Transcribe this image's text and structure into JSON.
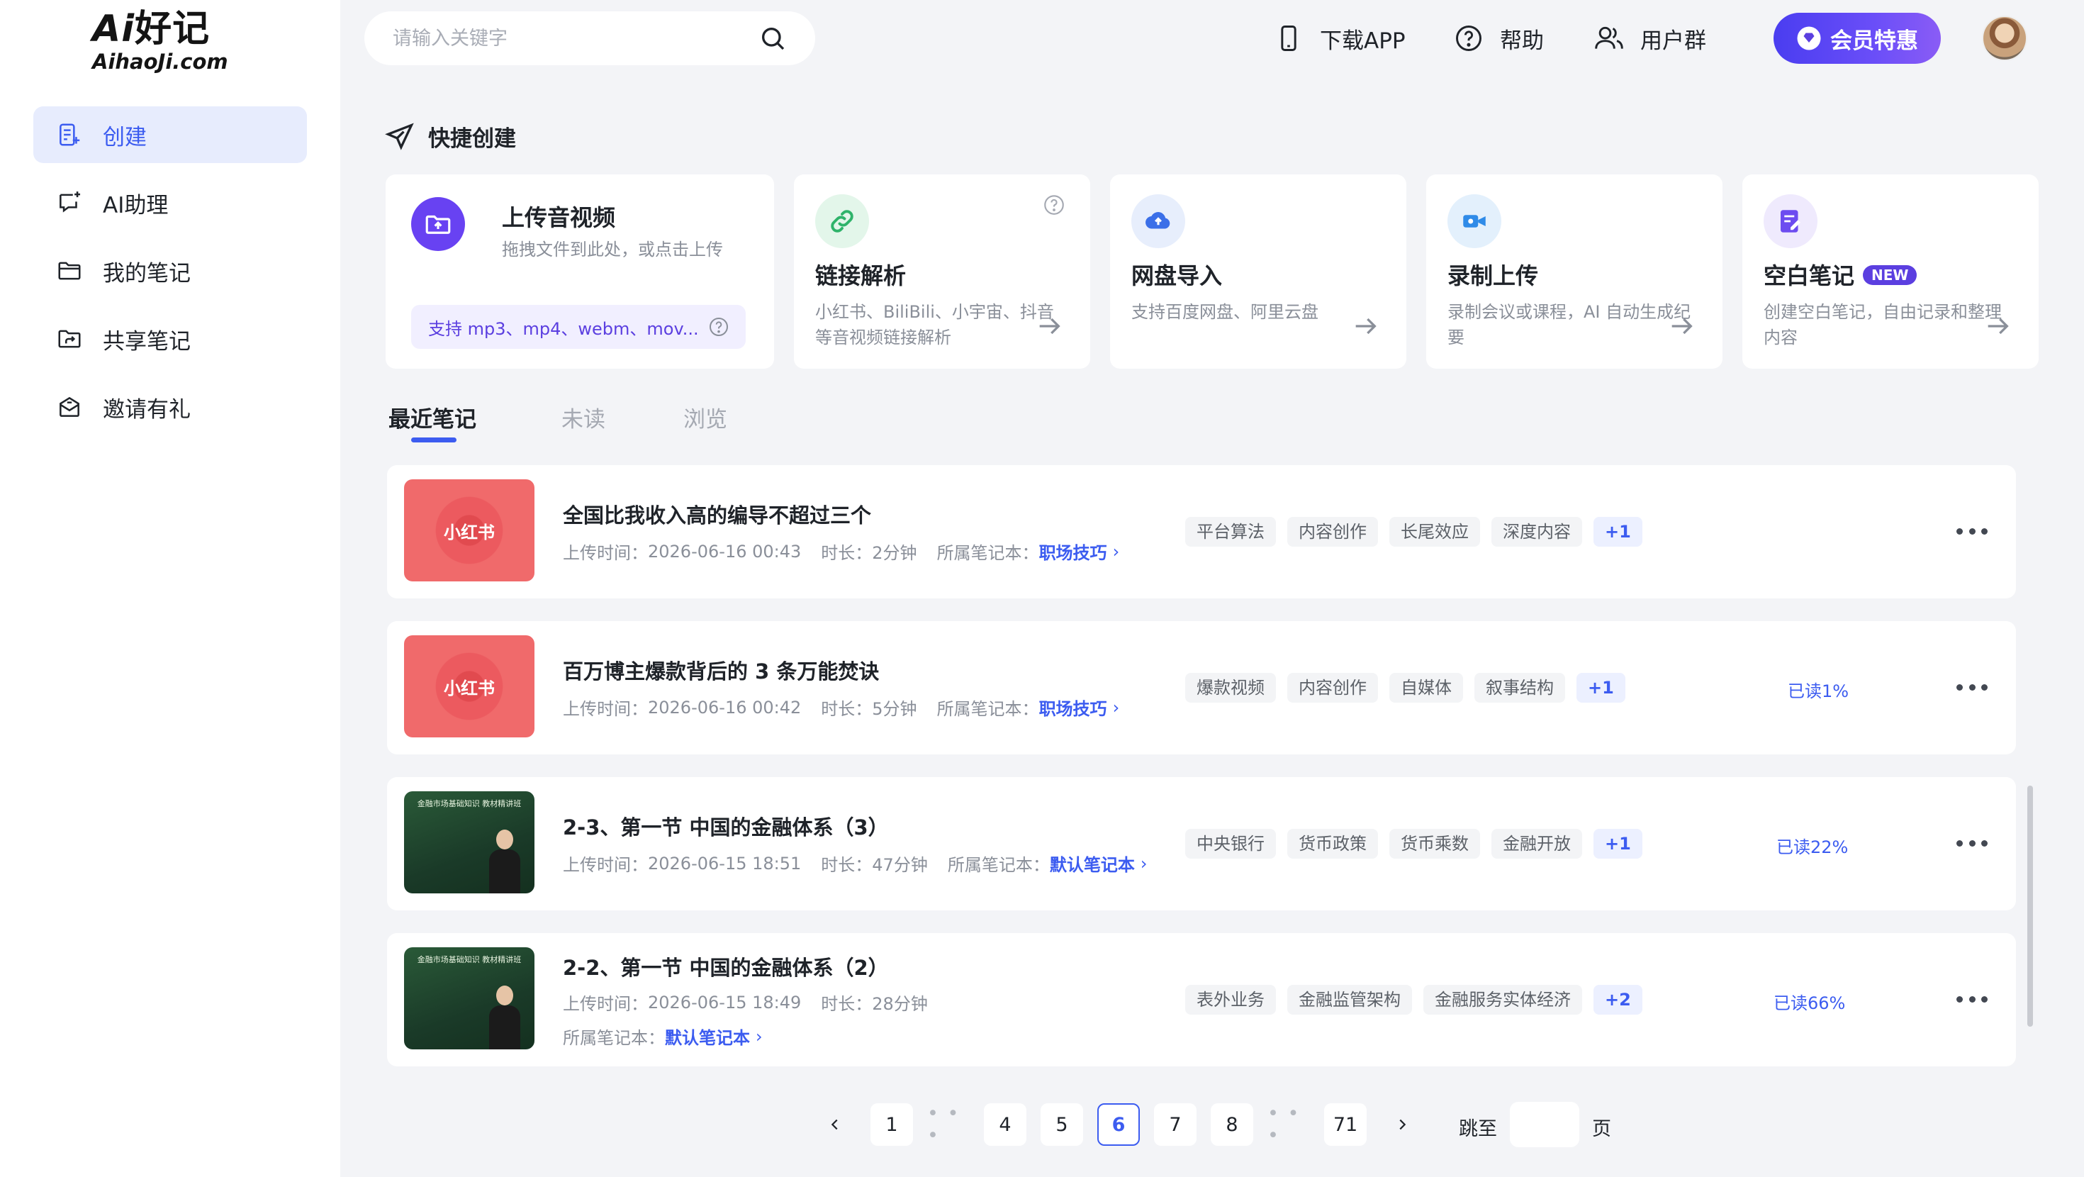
{
  "logo": {
    "top_ai": "Ai",
    "top_text": "好记",
    "bottom": "AihaoJi.com"
  },
  "sidebar": {
    "items": [
      {
        "label": "创建",
        "icon": "create-note-icon"
      },
      {
        "label": "AI助理",
        "icon": "ai-chat-icon"
      },
      {
        "label": "我的笔记",
        "icon": "folder-icon"
      },
      {
        "label": "共享笔记",
        "icon": "share-folder-icon"
      },
      {
        "label": "邀请有礼",
        "icon": "invite-mail-icon"
      }
    ]
  },
  "header": {
    "search_placeholder": "请输入关键字",
    "download_app": "下载APP",
    "help": "帮助",
    "user_group": "用户群",
    "vip": "会员特惠"
  },
  "quick_create": {
    "title": "快捷创建",
    "cards": [
      {
        "title": "上传音视频",
        "desc": "拖拽文件到此处，或点击上传",
        "formats": "支持 mp3、mp4、webm、mov..."
      },
      {
        "title": "链接解析",
        "desc": "小红书、BiliBili、小宇宙、抖音等音视频链接解析"
      },
      {
        "title": "网盘导入",
        "desc": "支持百度网盘、阿里云盘"
      },
      {
        "title": "录制上传",
        "desc": "录制会议或课程，AI 自动生成纪要"
      },
      {
        "title": "空白笔记",
        "badge": "NEW",
        "desc": "创建空白笔记，自由记录和整理内容"
      }
    ]
  },
  "tabs": [
    "最近笔记",
    "未读",
    "浏览"
  ],
  "meta_labels": {
    "upload_time": "上传时间：",
    "duration": "时长：",
    "notebook": "所属笔记本："
  },
  "notes": [
    {
      "thumb_text": "小红书",
      "title": "全国比我收入高的编导不超过三个",
      "upload_time": "2026-06-16 00:43",
      "duration": "2分钟",
      "notebook": "职场技巧",
      "tags": [
        "平台算法",
        "内容创作",
        "长尾效应",
        "深度内容"
      ],
      "more": "+1",
      "read": ""
    },
    {
      "thumb_text": "小红书",
      "title": "百万博主爆款背后的 3 条万能焚诀",
      "upload_time": "2026-06-16 00:42",
      "duration": "5分钟",
      "notebook": "职场技巧",
      "tags": [
        "爆款视频",
        "内容创作",
        "自媒体",
        "叙事结构"
      ],
      "more": "+1",
      "read": "已读1%"
    },
    {
      "thumb_text": "金融市场基础知识 教材精讲班",
      "title": "2-3、第一节 中国的金融体系（3）",
      "upload_time": "2026-06-15 18:51",
      "duration": "47分钟",
      "notebook": "默认笔记本",
      "tags": [
        "中央银行",
        "货币政策",
        "货币乘数",
        "金融开放"
      ],
      "more": "+1",
      "read": "已读22%"
    },
    {
      "thumb_text": "金融市场基础知识 教材精讲班",
      "title": "2-2、第一节 中国的金融体系（2）",
      "upload_time": "2026-06-15 18:49",
      "duration": "28分钟",
      "notebook": "默认笔记本",
      "tags": [
        "表外业务",
        "金融监管架构",
        "金融服务实体经济"
      ],
      "more": "+2",
      "read": "已读66%"
    }
  ],
  "pagination": {
    "pages": [
      "1",
      "4",
      "5",
      "6",
      "7",
      "8",
      "71"
    ],
    "current": "6",
    "ellipsis": "• • •",
    "jump_label": "跳至",
    "page_unit": "页",
    "jump_value": ""
  },
  "colors": {
    "accent": "#3c5cf0",
    "vip_purple": "#5b3fe0",
    "xhs_red": "#e14a4f"
  }
}
